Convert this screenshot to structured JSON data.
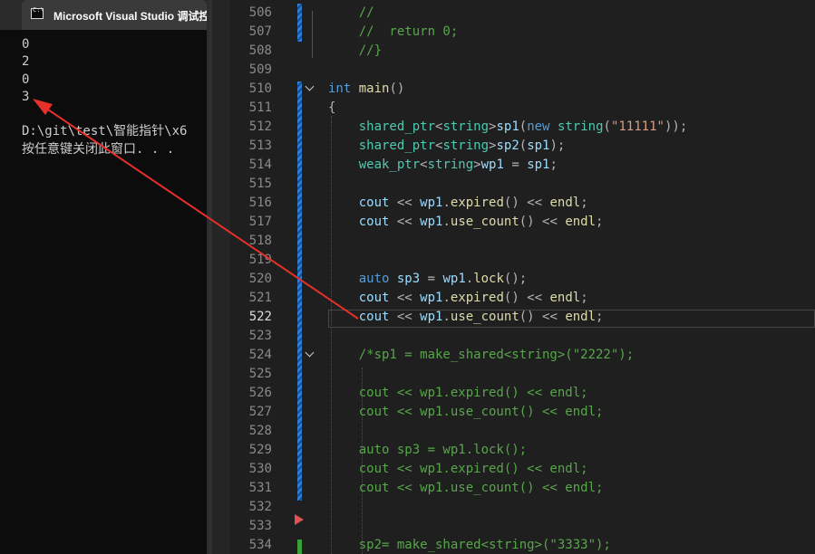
{
  "console": {
    "title": "Microsoft Visual Studio 调试控",
    "icon": "console-app-icon",
    "icon_text": "C:\\",
    "lines": [
      "0",
      "2",
      "0",
      "3",
      "",
      "D:\\git\\test\\智能指针\\x6",
      "按任意键关闭此窗口. . ."
    ]
  },
  "editor": {
    "active_line": "522",
    "lines": [
      {
        "n": "506",
        "tokens": [
          {
            "t": "    //",
            "c": "com"
          }
        ]
      },
      {
        "n": "507",
        "tokens": [
          {
            "t": "    //  return 0;",
            "c": "com"
          }
        ]
      },
      {
        "n": "508",
        "tokens": [
          {
            "t": "    //}",
            "c": "com"
          }
        ]
      },
      {
        "n": "509",
        "tokens": []
      },
      {
        "n": "510",
        "tokens": [
          {
            "t": "int",
            "c": "kw"
          },
          {
            "t": " ",
            "c": "p"
          },
          {
            "t": "main",
            "c": "fn"
          },
          {
            "t": "()",
            "c": "p"
          }
        ]
      },
      {
        "n": "511",
        "tokens": [
          {
            "t": "{",
            "c": "p"
          }
        ]
      },
      {
        "n": "512",
        "tokens": [
          {
            "t": "    shared_ptr",
            "c": "type"
          },
          {
            "t": "<",
            "c": "p"
          },
          {
            "t": "string",
            "c": "type"
          },
          {
            "t": ">",
            "c": "p"
          },
          {
            "t": "sp1",
            "c": "var"
          },
          {
            "t": "(",
            "c": "p"
          },
          {
            "t": "new",
            "c": "kw"
          },
          {
            "t": " ",
            "c": "p"
          },
          {
            "t": "string",
            "c": "type"
          },
          {
            "t": "(",
            "c": "p"
          },
          {
            "t": "\"11111\"",
            "c": "str"
          },
          {
            "t": "));",
            "c": "p"
          }
        ]
      },
      {
        "n": "513",
        "tokens": [
          {
            "t": "    shared_ptr",
            "c": "type"
          },
          {
            "t": "<",
            "c": "p"
          },
          {
            "t": "string",
            "c": "type"
          },
          {
            "t": ">",
            "c": "p"
          },
          {
            "t": "sp2",
            "c": "var"
          },
          {
            "t": "(",
            "c": "p"
          },
          {
            "t": "sp1",
            "c": "var"
          },
          {
            "t": ");",
            "c": "p"
          }
        ]
      },
      {
        "n": "514",
        "tokens": [
          {
            "t": "    weak_ptr",
            "c": "type"
          },
          {
            "t": "<",
            "c": "p"
          },
          {
            "t": "string",
            "c": "type"
          },
          {
            "t": ">",
            "c": "p"
          },
          {
            "t": "wp1",
            "c": "var"
          },
          {
            "t": " = ",
            "c": "p"
          },
          {
            "t": "sp1",
            "c": "var"
          },
          {
            "t": ";",
            "c": "p"
          }
        ]
      },
      {
        "n": "515",
        "tokens": []
      },
      {
        "n": "516",
        "tokens": [
          {
            "t": "    cout",
            "c": "var"
          },
          {
            "t": " << ",
            "c": "p"
          },
          {
            "t": "wp1",
            "c": "var"
          },
          {
            "t": ".",
            "c": "p"
          },
          {
            "t": "expired",
            "c": "fn"
          },
          {
            "t": "() << ",
            "c": "p"
          },
          {
            "t": "endl",
            "c": "fn"
          },
          {
            "t": ";",
            "c": "p"
          }
        ]
      },
      {
        "n": "517",
        "tokens": [
          {
            "t": "    cout",
            "c": "var"
          },
          {
            "t": " << ",
            "c": "p"
          },
          {
            "t": "wp1",
            "c": "var"
          },
          {
            "t": ".",
            "c": "p"
          },
          {
            "t": "use_count",
            "c": "fn"
          },
          {
            "t": "() << ",
            "c": "p"
          },
          {
            "t": "endl",
            "c": "fn"
          },
          {
            "t": ";",
            "c": "p"
          }
        ]
      },
      {
        "n": "518",
        "tokens": []
      },
      {
        "n": "519",
        "tokens": []
      },
      {
        "n": "520",
        "tokens": [
          {
            "t": "    auto",
            "c": "kw"
          },
          {
            "t": " ",
            "c": "p"
          },
          {
            "t": "sp3",
            "c": "var"
          },
          {
            "t": " = ",
            "c": "p"
          },
          {
            "t": "wp1",
            "c": "var"
          },
          {
            "t": ".",
            "c": "p"
          },
          {
            "t": "lock",
            "c": "fn"
          },
          {
            "t": "();",
            "c": "p"
          }
        ]
      },
      {
        "n": "521",
        "tokens": [
          {
            "t": "    cout",
            "c": "var"
          },
          {
            "t": " << ",
            "c": "p"
          },
          {
            "t": "wp1",
            "c": "var"
          },
          {
            "t": ".",
            "c": "p"
          },
          {
            "t": "expired",
            "c": "fn"
          },
          {
            "t": "() << ",
            "c": "p"
          },
          {
            "t": "endl",
            "c": "fn"
          },
          {
            "t": ";",
            "c": "p"
          }
        ]
      },
      {
        "n": "522",
        "tokens": [
          {
            "t": "    cout",
            "c": "var"
          },
          {
            "t": " << ",
            "c": "p"
          },
          {
            "t": "wp1",
            "c": "var"
          },
          {
            "t": ".",
            "c": "p"
          },
          {
            "t": "use_count",
            "c": "fn"
          },
          {
            "t": "() << ",
            "c": "p"
          },
          {
            "t": "endl",
            "c": "fn"
          },
          {
            "t": ";",
            "c": "p"
          }
        ]
      },
      {
        "n": "523",
        "tokens": []
      },
      {
        "n": "524",
        "tokens": [
          {
            "t": "    /*sp1 = make_shared<string>(\"2222\");",
            "c": "com"
          }
        ]
      },
      {
        "n": "525",
        "tokens": []
      },
      {
        "n": "526",
        "tokens": [
          {
            "t": "    cout << wp1.expired() << endl;",
            "c": "com"
          }
        ]
      },
      {
        "n": "527",
        "tokens": [
          {
            "t": "    cout << wp1.use_count() << endl;",
            "c": "com"
          }
        ]
      },
      {
        "n": "528",
        "tokens": []
      },
      {
        "n": "529",
        "tokens": [
          {
            "t": "    auto sp3 = wp1.lock();",
            "c": "com"
          }
        ]
      },
      {
        "n": "530",
        "tokens": [
          {
            "t": "    cout << wp1.expired() << endl;",
            "c": "com"
          }
        ]
      },
      {
        "n": "531",
        "tokens": [
          {
            "t": "    cout << wp1.use_count() << endl;",
            "c": "com"
          }
        ]
      },
      {
        "n": "532",
        "tokens": []
      },
      {
        "n": "533",
        "tokens": []
      },
      {
        "n": "534",
        "tokens": [
          {
            "t": "    sp2= make_shared<string>(\"3333\");",
            "c": "com"
          }
        ]
      }
    ]
  },
  "colors": {
    "annotation_arrow": "#e8302a",
    "change_marker": "#2b7fd8",
    "saved_marker": "#3aa13a"
  }
}
